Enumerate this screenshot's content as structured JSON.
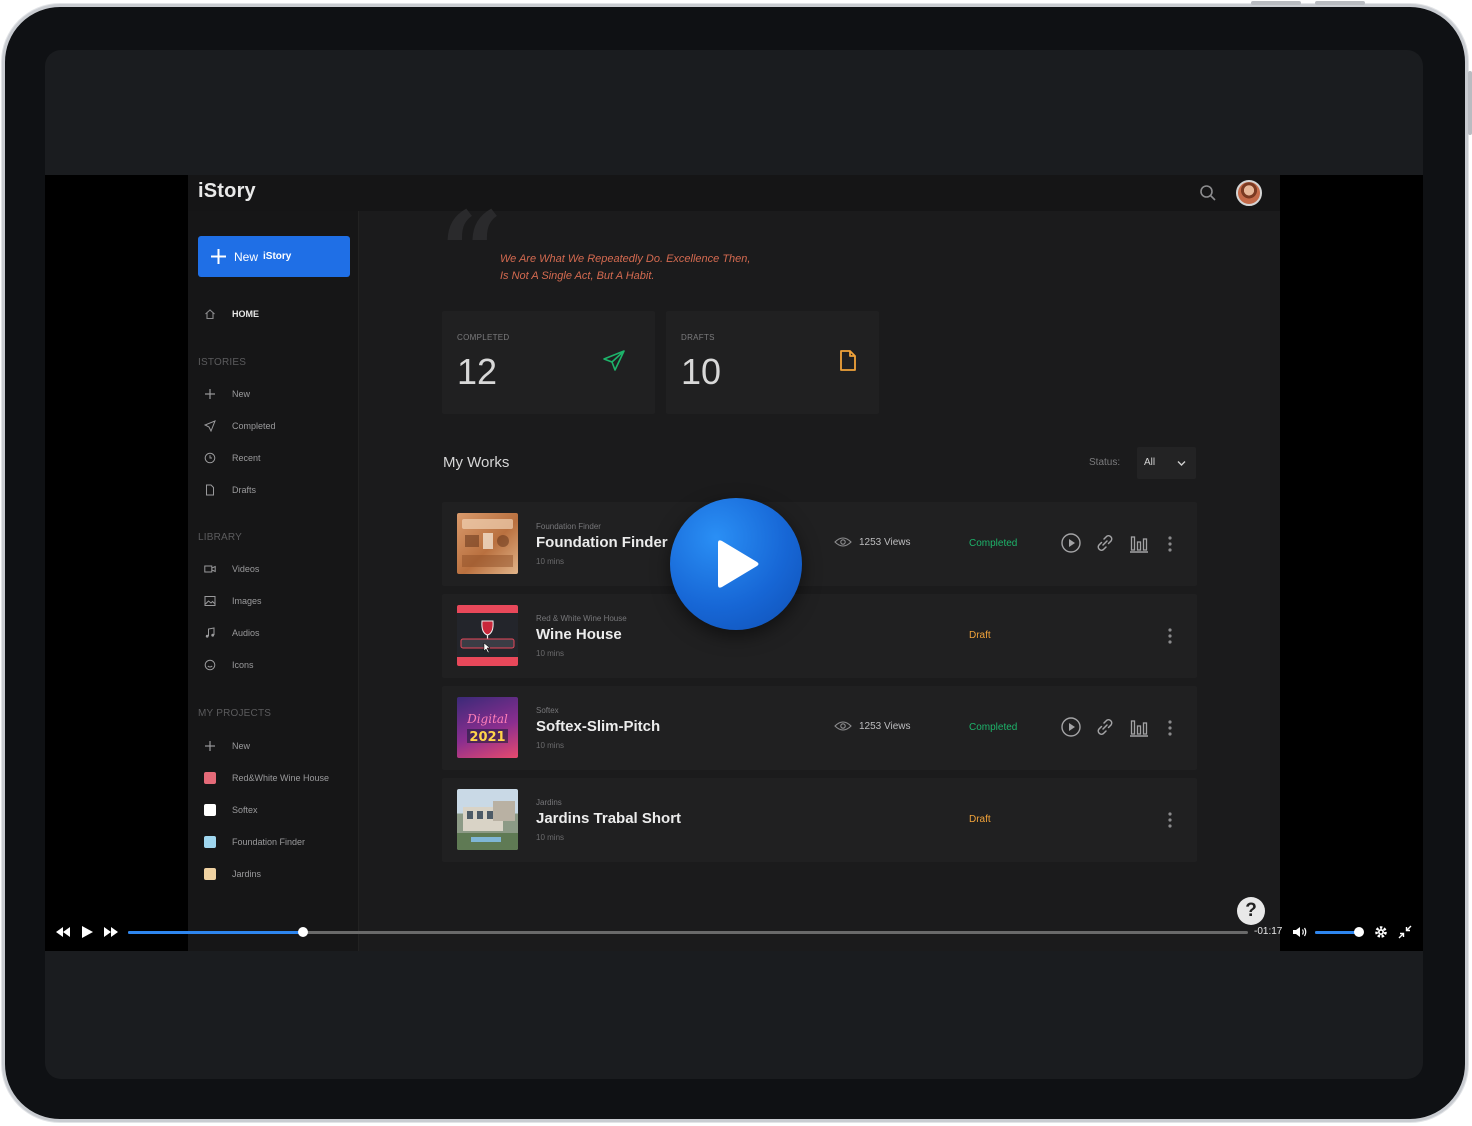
{
  "app": {
    "logo": "iStory"
  },
  "sidebar": {
    "new_button": {
      "label": "New",
      "brand": "iStory"
    },
    "home": "HOME",
    "stories_title": "ISTORIES",
    "stories": [
      {
        "label": "New",
        "icon": "plus-icon"
      },
      {
        "label": "Completed",
        "icon": "send-icon"
      },
      {
        "label": "Recent",
        "icon": "clock-icon"
      },
      {
        "label": "Drafts",
        "icon": "file-icon"
      }
    ],
    "library_title": "LIBRARY",
    "library": [
      {
        "label": "Videos",
        "icon": "video-icon"
      },
      {
        "label": "Images",
        "icon": "image-icon"
      },
      {
        "label": "Audios",
        "icon": "music-icon"
      },
      {
        "label": "Icons",
        "icon": "smile-icon"
      }
    ],
    "projects_title": "MY PROJECTS",
    "projects": [
      {
        "label": "New",
        "color": ""
      },
      {
        "label": "Red&White Wine House",
        "color": "#e46a78"
      },
      {
        "label": "Softex",
        "color": "#ffffff"
      },
      {
        "label": "Foundation Finder",
        "color": "#9fd6ef"
      },
      {
        "label": "Jardins",
        "color": "#efd2a2"
      }
    ]
  },
  "quote": {
    "line1": "We Are What We Repeatedly Do. Excellence Then,",
    "line2": "Is Not A Single Act, But A Habit."
  },
  "stats": {
    "completed": {
      "label": "COMPLETED",
      "value": "12",
      "color": "#1db36a"
    },
    "drafts": {
      "label": "DRAFTS",
      "value": "10",
      "color": "#f0a23a"
    }
  },
  "works": {
    "title": "My Works",
    "status_label": "Status:",
    "status_value": "All",
    "rows": [
      {
        "project": "Foundation Finder",
        "title": "Foundation Finder",
        "mins": "10 mins",
        "views": "1253 Views",
        "status": "Completed"
      },
      {
        "project": "Red & White Wine House",
        "title": "Wine House",
        "mins": "10 mins",
        "views": "",
        "status": "Draft"
      },
      {
        "project": "Softex",
        "title": "Softex-Slim-Pitch",
        "mins": "10 mins",
        "views": "1253 Views",
        "status": "Completed",
        "thumb_text": "2021"
      },
      {
        "project": "Jardins",
        "title": "Jardins Trabal Short",
        "mins": "10 mins",
        "views": "",
        "status": "Draft"
      }
    ],
    "status_colors": {
      "Completed": "#1db36a",
      "Draft": "#f0a23a"
    }
  },
  "player": {
    "time_remaining": "-01:17",
    "progress_fraction": 0.156,
    "volume_fraction": 0.95,
    "help_label": "?"
  },
  "colors": {
    "accent": "#1f6fe6",
    "play_button": "#1767d6"
  }
}
